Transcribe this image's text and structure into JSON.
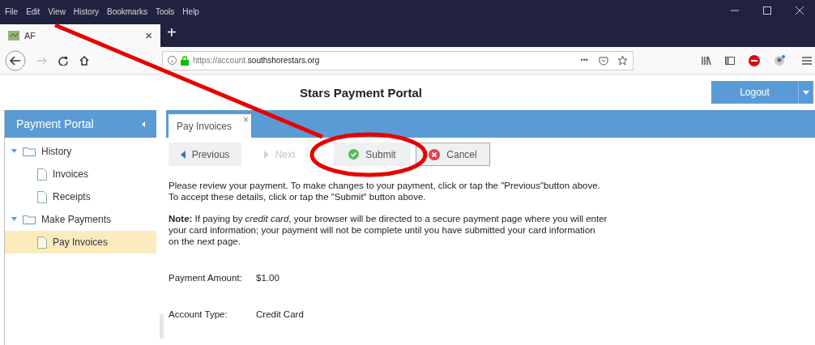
{
  "menu": [
    "File",
    "Edit",
    "View",
    "History",
    "Bookmarks",
    "Tools",
    "Help"
  ],
  "browser_tab": {
    "title": "AF",
    "close": "×",
    "new_tab": "+"
  },
  "address": {
    "prefix": "https://account.",
    "domain": "southshorestars.org",
    "more": "•••"
  },
  "header": {
    "title": "Stars Payment Portal",
    "logout": "Logout"
  },
  "sidebar": {
    "title": "Payment Portal",
    "items": [
      {
        "label": "History",
        "kind": "folder",
        "expanded": true,
        "children": [
          {
            "label": "Invoices",
            "kind": "page",
            "selected": false
          },
          {
            "label": "Receipts",
            "kind": "page",
            "selected": false
          }
        ]
      },
      {
        "label": "Make Payments",
        "kind": "folder",
        "expanded": true,
        "children": [
          {
            "label": "Pay Invoices",
            "kind": "page",
            "selected": true
          }
        ]
      }
    ]
  },
  "page_tab": {
    "label": "Pay Invoices",
    "close": "×"
  },
  "toolbar": [
    {
      "label": "Previous",
      "kind": "previous",
      "disabled": false
    },
    {
      "label": "Next",
      "kind": "next",
      "disabled": true
    },
    {
      "label": "Submit",
      "kind": "submit",
      "disabled": false
    },
    {
      "label": "Cancel",
      "kind": "cancel",
      "disabled": false
    }
  ],
  "paragraphs": [
    "Please review your payment. To make changes to your payment, click or tap the \"Previous\"button above.\nTo accept these details, click or tap the \"Submit\" button above.",
    "**Note:** If paying by *credit card*, your browser will be directed to a secure payment page where you will enter\nyour card information; your payment will not be complete until you have submitted your card information\non the next page."
  ],
  "fields": [
    {
      "label": "Payment Amount:",
      "value": "$1.00"
    },
    {
      "label": "Account Type:",
      "value": "Credit Card"
    }
  ]
}
